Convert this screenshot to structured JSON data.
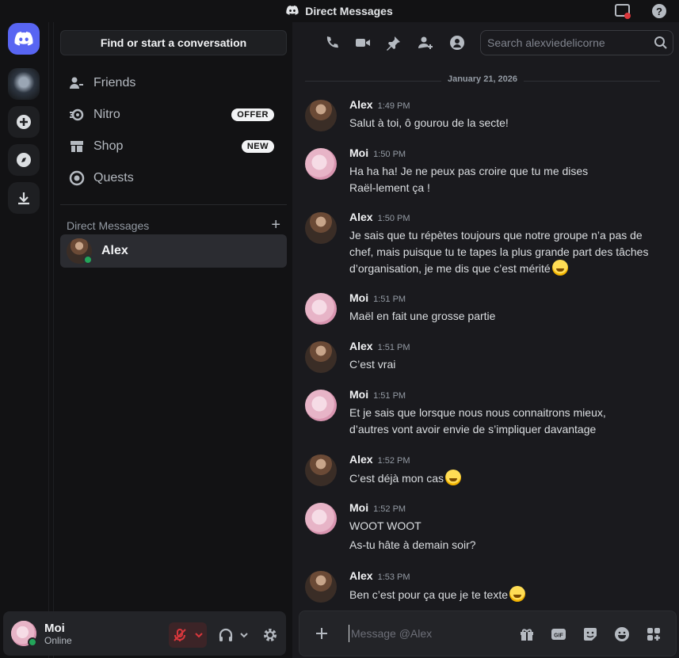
{
  "window": {
    "title": "Direct Messages"
  },
  "sidebar": {
    "find_placeholder": "Find or start a conversation",
    "nav": [
      {
        "label": "Friends",
        "icon": "friends-icon"
      },
      {
        "label": "Nitro",
        "icon": "nitro-icon",
        "badge": "OFFER"
      },
      {
        "label": "Shop",
        "icon": "shop-icon",
        "badge": "NEW"
      },
      {
        "label": "Quests",
        "icon": "quests-icon"
      }
    ],
    "dm_header": "Direct Messages",
    "dm_add": "+",
    "dms": [
      {
        "name": "Alex",
        "status": "online"
      }
    ]
  },
  "user": {
    "name": "Moi",
    "status": "Online"
  },
  "chat": {
    "search_placeholder": "Search alexviedelicorne",
    "date": "January 21, 2026",
    "messages": [
      {
        "author": "Alex",
        "time": "1:49 PM",
        "text": "Salut à toi, ô gourou de la secte!"
      },
      {
        "author": "Moi",
        "time": "1:50 PM",
        "text": "Ha ha ha! Je ne peux pas croire que tu me dises  Raël-lement ça !"
      },
      {
        "author": "Alex",
        "time": "1:50 PM",
        "text": "Je sais que tu répètes toujours que notre groupe n’a pas de chef, mais puisque tu te tapes la plus grande part des tâches d’organisation, je me dis que c’est mérité"
      },
      {
        "author": "Moi",
        "time": "1:51 PM",
        "text": "Maël en fait une grosse partie"
      },
      {
        "author": "Alex",
        "time": "1:51 PM",
        "text": "C’est vrai"
      },
      {
        "author": "Moi",
        "time": "1:51 PM",
        "text": "Et je sais que lorsque nous nous connaitrons mieux, d’autres vont avoir envie de s’impliquer davantage"
      },
      {
        "author": "Alex",
        "time": "1:52 PM",
        "text": "C’est déjà mon cas"
      },
      {
        "author": "Moi",
        "time": "1:52 PM",
        "text": "WOOT WOOT",
        "text2": "As-tu hâte à demain soir?"
      },
      {
        "author": "Alex",
        "time": "1:53 PM",
        "text": "Ben c’est pour ça que je te texte"
      }
    ],
    "composer_placeholder": "Message @Alex"
  },
  "colors": {
    "accent": "#5865f2",
    "online": "#23a55a",
    "mute_red": "#da373c"
  }
}
